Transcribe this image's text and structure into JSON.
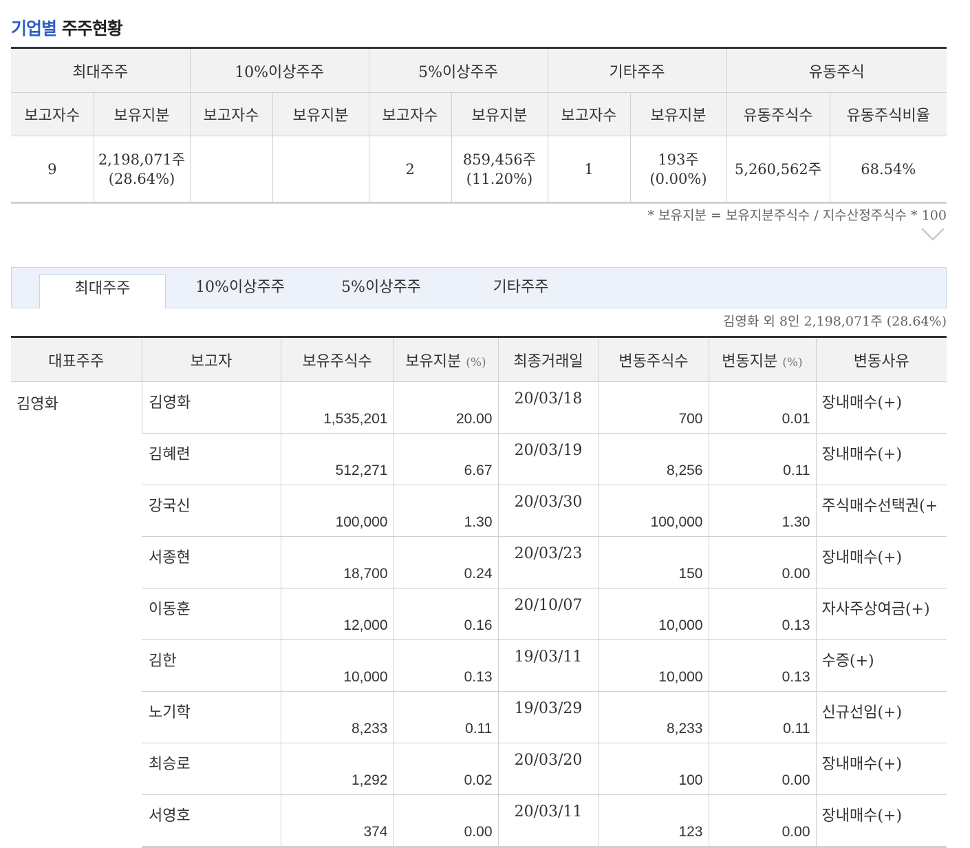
{
  "title": {
    "accent": "기업별",
    "rest": " 주주현황"
  },
  "summary": {
    "groups": [
      "최대주주",
      "10%이상주주",
      "5%이상주주",
      "기타주주",
      "유동주식"
    ],
    "subheaders": [
      "보고자수",
      "보유지분",
      "보고자수",
      "보유지분",
      "보고자수",
      "보유지분",
      "보고자수",
      "보유지분",
      "유동주식수",
      "유동주식비율"
    ],
    "values": [
      "9",
      "2,198,071주 (28.64%)",
      "",
      "",
      "2",
      "859,456주 (11.20%)",
      "1",
      "193주 (0.00%)",
      "5,260,562주",
      "68.54%"
    ],
    "note": "* 보유지분 = 보유지분주식수 / 지수산정주식수 * 100"
  },
  "tabs": [
    "최대주주",
    "10%이상주주",
    "5%이상주주",
    "기타주주"
  ],
  "holder_summary": "김영화 외 8인 2,198,071주 (28.64%)",
  "detail": {
    "headers": {
      "rep": "대표주주",
      "reporter": "보고자",
      "shares": "보유주식수",
      "stake": "보유지분",
      "stake_unit": "(%)",
      "last_date": "최종거래일",
      "change_shares": "변동주식수",
      "change_stake": "변동지분",
      "change_unit": "(%)",
      "reason": "변동사유"
    },
    "representative": "김영화",
    "rows": [
      {
        "name": "김영화",
        "shares": "1,535,201",
        "stake": "20.00",
        "date": "20/03/18",
        "change": "700",
        "change_stake": "0.01",
        "reason": "장내매수(+)"
      },
      {
        "name": "김혜련",
        "shares": "512,271",
        "stake": "6.67",
        "date": "20/03/19",
        "change": "8,256",
        "change_stake": "0.11",
        "reason": "장내매수(+)"
      },
      {
        "name": "강국신",
        "shares": "100,000",
        "stake": "1.30",
        "date": "20/03/30",
        "change": "100,000",
        "change_stake": "1.30",
        "reason": "주식매수선택권(+"
      },
      {
        "name": "서종현",
        "shares": "18,700",
        "stake": "0.24",
        "date": "20/03/23",
        "change": "150",
        "change_stake": "0.00",
        "reason": "장내매수(+)"
      },
      {
        "name": "이동훈",
        "shares": "12,000",
        "stake": "0.16",
        "date": "20/10/07",
        "change": "10,000",
        "change_stake": "0.13",
        "reason": "자사주상여금(+)"
      },
      {
        "name": "김한",
        "shares": "10,000",
        "stake": "0.13",
        "date": "19/03/11",
        "change": "10,000",
        "change_stake": "0.13",
        "reason": "수증(+)"
      },
      {
        "name": "노기학",
        "shares": "8,233",
        "stake": "0.11",
        "date": "19/03/29",
        "change": "8,233",
        "change_stake": "0.11",
        "reason": "신규선임(+)"
      },
      {
        "name": "최승로",
        "shares": "1,292",
        "stake": "0.02",
        "date": "20/03/20",
        "change": "100",
        "change_stake": "0.00",
        "reason": "장내매수(+)"
      },
      {
        "name": "서영호",
        "shares": "374",
        "stake": "0.00",
        "date": "20/03/11",
        "change": "123",
        "change_stake": "0.00",
        "reason": "장내매수(+)"
      }
    ]
  }
}
